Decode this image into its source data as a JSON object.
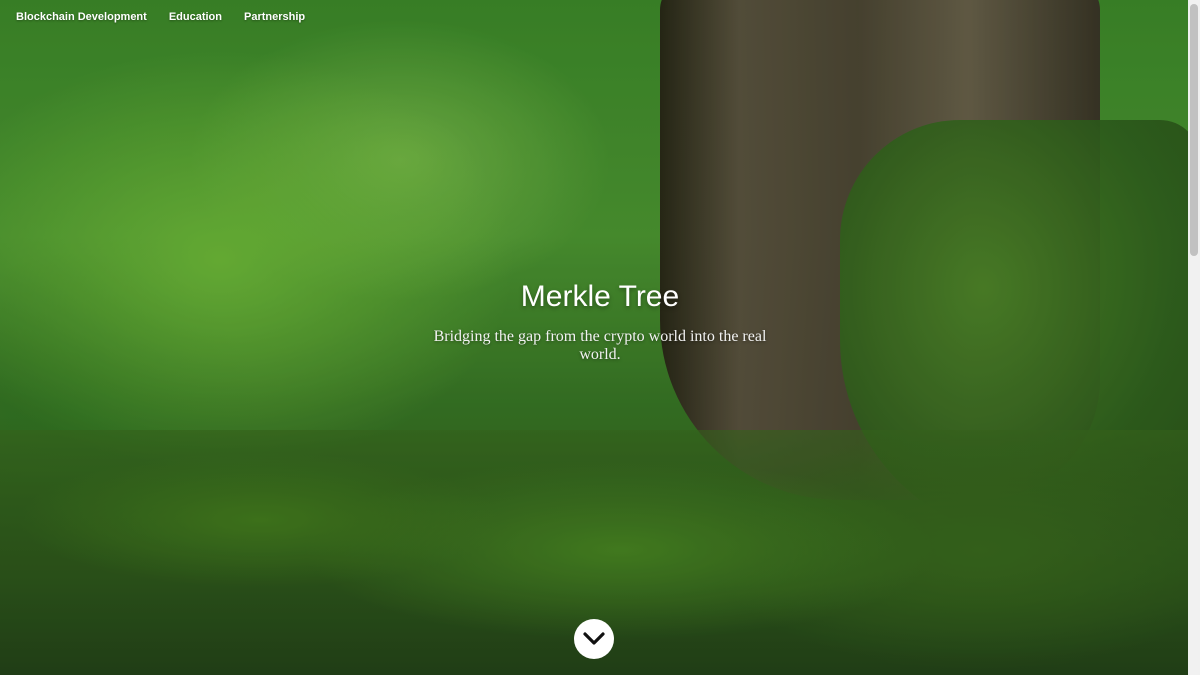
{
  "nav": {
    "items": [
      {
        "label": "Blockchain Development"
      },
      {
        "label": "Education"
      },
      {
        "label": "Partnership"
      }
    ]
  },
  "hero": {
    "title": "Merkle Tree",
    "subtitle": "Bridging the gap from the crypto world into the real world."
  },
  "scroll_button": {
    "icon": "chevron-down-icon"
  },
  "colors": {
    "text": "#ffffff",
    "button_bg": "#ffffff",
    "icon": "#111111"
  }
}
